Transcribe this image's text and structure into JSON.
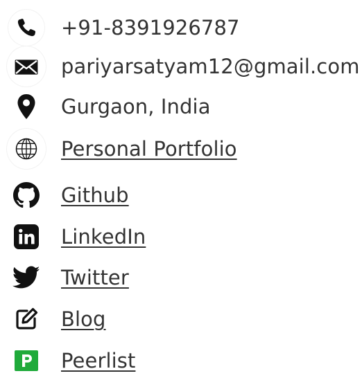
{
  "contacts": [
    {
      "type": "phone",
      "icon": "phone-icon",
      "text": "+91-8391926787",
      "link": false
    },
    {
      "type": "email",
      "icon": "envelope-icon",
      "text": "pariyarsatyam12@gmail.com",
      "link": false
    },
    {
      "type": "location",
      "icon": "location-pin-icon",
      "text": "Gurgaon, India",
      "link": false
    },
    {
      "type": "portfolio",
      "icon": "globe-icon",
      "text": "Personal Portfolio",
      "link": true
    },
    {
      "type": "github",
      "icon": "github-icon",
      "text": "Github",
      "link": true
    },
    {
      "type": "linkedin",
      "icon": "linkedin-icon",
      "text": "LinkedIn",
      "link": true
    },
    {
      "type": "twitter",
      "icon": "twitter-icon",
      "text": "Twitter",
      "link": true
    },
    {
      "type": "blog",
      "icon": "edit-icon",
      "text": "Blog",
      "link": true
    },
    {
      "type": "peerlist",
      "icon": "peerlist-icon",
      "text": "Peerlist",
      "link": true
    }
  ],
  "colors": {
    "text": "#333333",
    "icon": "#111111",
    "peerlist_green": "#1faa3a"
  }
}
